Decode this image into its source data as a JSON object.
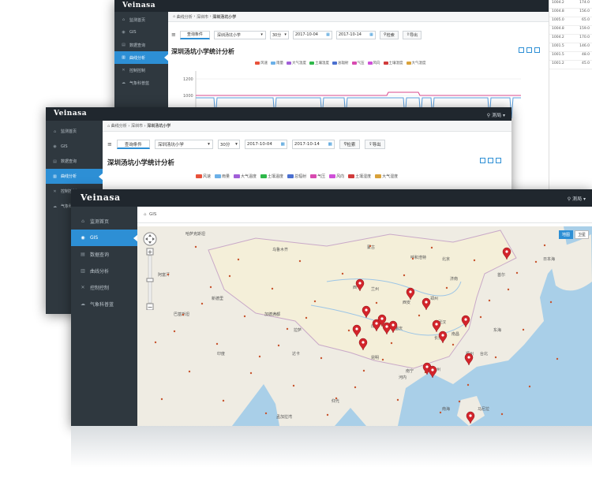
{
  "brand": "Veinasa",
  "user": "测局",
  "sidebar": [
    {
      "icon": "home-icon",
      "label": "监测首页"
    },
    {
      "icon": "map-pin-icon",
      "label": "GIS"
    },
    {
      "icon": "database-icon",
      "label": "数据查询"
    },
    {
      "icon": "chart-icon",
      "label": "曲线分析"
    },
    {
      "icon": "tools-icon",
      "label": "控制控制"
    },
    {
      "icon": "weather-icon",
      "label": "气象科普蓝"
    }
  ],
  "back_window": {
    "breadcrumb": [
      "曲线分析",
      "深圳市",
      "深圳汤坑小学"
    ],
    "toolbar": {
      "query_label": "查询条件",
      "station": "深圳汤坑小学",
      "interval": "30分",
      "start_date": "2017-10-04",
      "end_date": "2017-10-14",
      "search_label": "检索",
      "export_label": "导出"
    },
    "chart_data": {
      "type": "line",
      "title": "深圳汤坑小学统计分析",
      "legend": [
        "风速",
        "雨量",
        "大气温度",
        "土壤温度",
        "总辐射",
        "气压",
        "风向",
        "土壤湿度",
        "大气湿度"
      ],
      "yticks": [
        "1200",
        "1000"
      ],
      "series_colors": [
        "#e8513a",
        "#6bb0e8",
        "#a15fd8",
        "#2fb84a",
        "#4a6fd0",
        "#d84ab0",
        "#cf4fd8",
        "#d13b3b",
        "#d9a23a"
      ]
    },
    "table": [
      [
        "1004.2",
        "174.0"
      ],
      [
        "1004.8",
        "156.0"
      ],
      [
        "1005.0",
        "65.0"
      ],
      [
        "1004.8",
        "159.0"
      ],
      [
        "1004.2",
        "170.0"
      ],
      [
        "1001.5",
        "146.0"
      ],
      [
        "1001.5",
        "48.0"
      ],
      [
        "1001.2",
        "45.0"
      ]
    ]
  },
  "mid_window": {
    "breadcrumb": [
      "曲线分析",
      "深圳市",
      "深圳汤坑小学"
    ],
    "toolbar": {
      "query_label": "查询条件",
      "station": "深圳汤坑小学",
      "interval": "30分",
      "start_date": "2017-10-04",
      "end_date": "2017-10-14",
      "search_label": "检索",
      "export_label": "导出"
    },
    "chart_title": "深圳汤坑小学统计分析",
    "legend": [
      "风速",
      "雨量",
      "大气温度",
      "土壤温度",
      "总辐射",
      "气压",
      "风向",
      "土壤湿度",
      "大气湿度"
    ]
  },
  "front_window": {
    "breadcrumb": "GIS",
    "map_type_buttons": [
      "地图",
      "卫星"
    ],
    "map_labels": [
      {
        "text": "北京",
        "x": 560,
        "y": 330
      },
      {
        "text": "兰州",
        "x": 470,
        "y": 368
      },
      {
        "text": "西宁",
        "x": 447,
        "y": 366
      },
      {
        "text": "成都",
        "x": 470,
        "y": 415
      },
      {
        "text": "重庆",
        "x": 500,
        "y": 418
      },
      {
        "text": "郑州",
        "x": 545,
        "y": 380
      },
      {
        "text": "武汉",
        "x": 555,
        "y": 410
      },
      {
        "text": "长沙",
        "x": 550,
        "y": 430
      },
      {
        "text": "南昌",
        "x": 572,
        "y": 425
      },
      {
        "text": "福州",
        "x": 590,
        "y": 450
      },
      {
        "text": "广州",
        "x": 548,
        "y": 470
      },
      {
        "text": "南宁",
        "x": 514,
        "y": 472
      },
      {
        "text": "昆明",
        "x": 470,
        "y": 455
      },
      {
        "text": "拉萨",
        "x": 372,
        "y": 420
      },
      {
        "text": "西安",
        "x": 510,
        "y": 385
      },
      {
        "text": "济南",
        "x": 570,
        "y": 355
      },
      {
        "text": "台北",
        "x": 608,
        "y": 450
      },
      {
        "text": "日本海",
        "x": 688,
        "y": 330
      },
      {
        "text": "东海",
        "x": 625,
        "y": 420
      },
      {
        "text": "南海",
        "x": 560,
        "y": 520
      },
      {
        "text": "孟加拉湾",
        "x": 350,
        "y": 530
      },
      {
        "text": "新德里",
        "x": 268,
        "y": 380
      },
      {
        "text": "加德满都",
        "x": 335,
        "y": 400
      },
      {
        "text": "达卡",
        "x": 370,
        "y": 450
      },
      {
        "text": "仰光",
        "x": 420,
        "y": 510
      },
      {
        "text": "河内",
        "x": 505,
        "y": 480
      },
      {
        "text": "马尼拉",
        "x": 605,
        "y": 520
      },
      {
        "text": "首尔",
        "x": 630,
        "y": 350
      },
      {
        "text": "乌鲁木齐",
        "x": 345,
        "y": 318
      },
      {
        "text": "呼和浩特",
        "x": 520,
        "y": 328
      },
      {
        "text": "哈萨克斯坦",
        "x": 235,
        "y": 298
      },
      {
        "text": "蒙古",
        "x": 465,
        "y": 315
      },
      {
        "text": "印度",
        "x": 275,
        "y": 450
      },
      {
        "text": "巴基斯坦",
        "x": 220,
        "y": 400
      },
      {
        "text": "阿富汗",
        "x": 200,
        "y": 350
      }
    ],
    "markers": [
      {
        "x": 456,
        "y": 362
      },
      {
        "x": 464,
        "y": 396
      },
      {
        "x": 452,
        "y": 420
      },
      {
        "x": 460,
        "y": 437
      },
      {
        "x": 477,
        "y": 413
      },
      {
        "x": 484,
        "y": 407
      },
      {
        "x": 490,
        "y": 417
      },
      {
        "x": 498,
        "y": 415
      },
      {
        "x": 520,
        "y": 373
      },
      {
        "x": 540,
        "y": 386
      },
      {
        "x": 553,
        "y": 414
      },
      {
        "x": 561,
        "y": 428
      },
      {
        "x": 590,
        "y": 408
      },
      {
        "x": 594,
        "y": 456
      },
      {
        "x": 541,
        "y": 468
      },
      {
        "x": 548,
        "y": 472
      },
      {
        "x": 642,
        "y": 322
      },
      {
        "x": 596,
        "y": 530
      }
    ]
  }
}
